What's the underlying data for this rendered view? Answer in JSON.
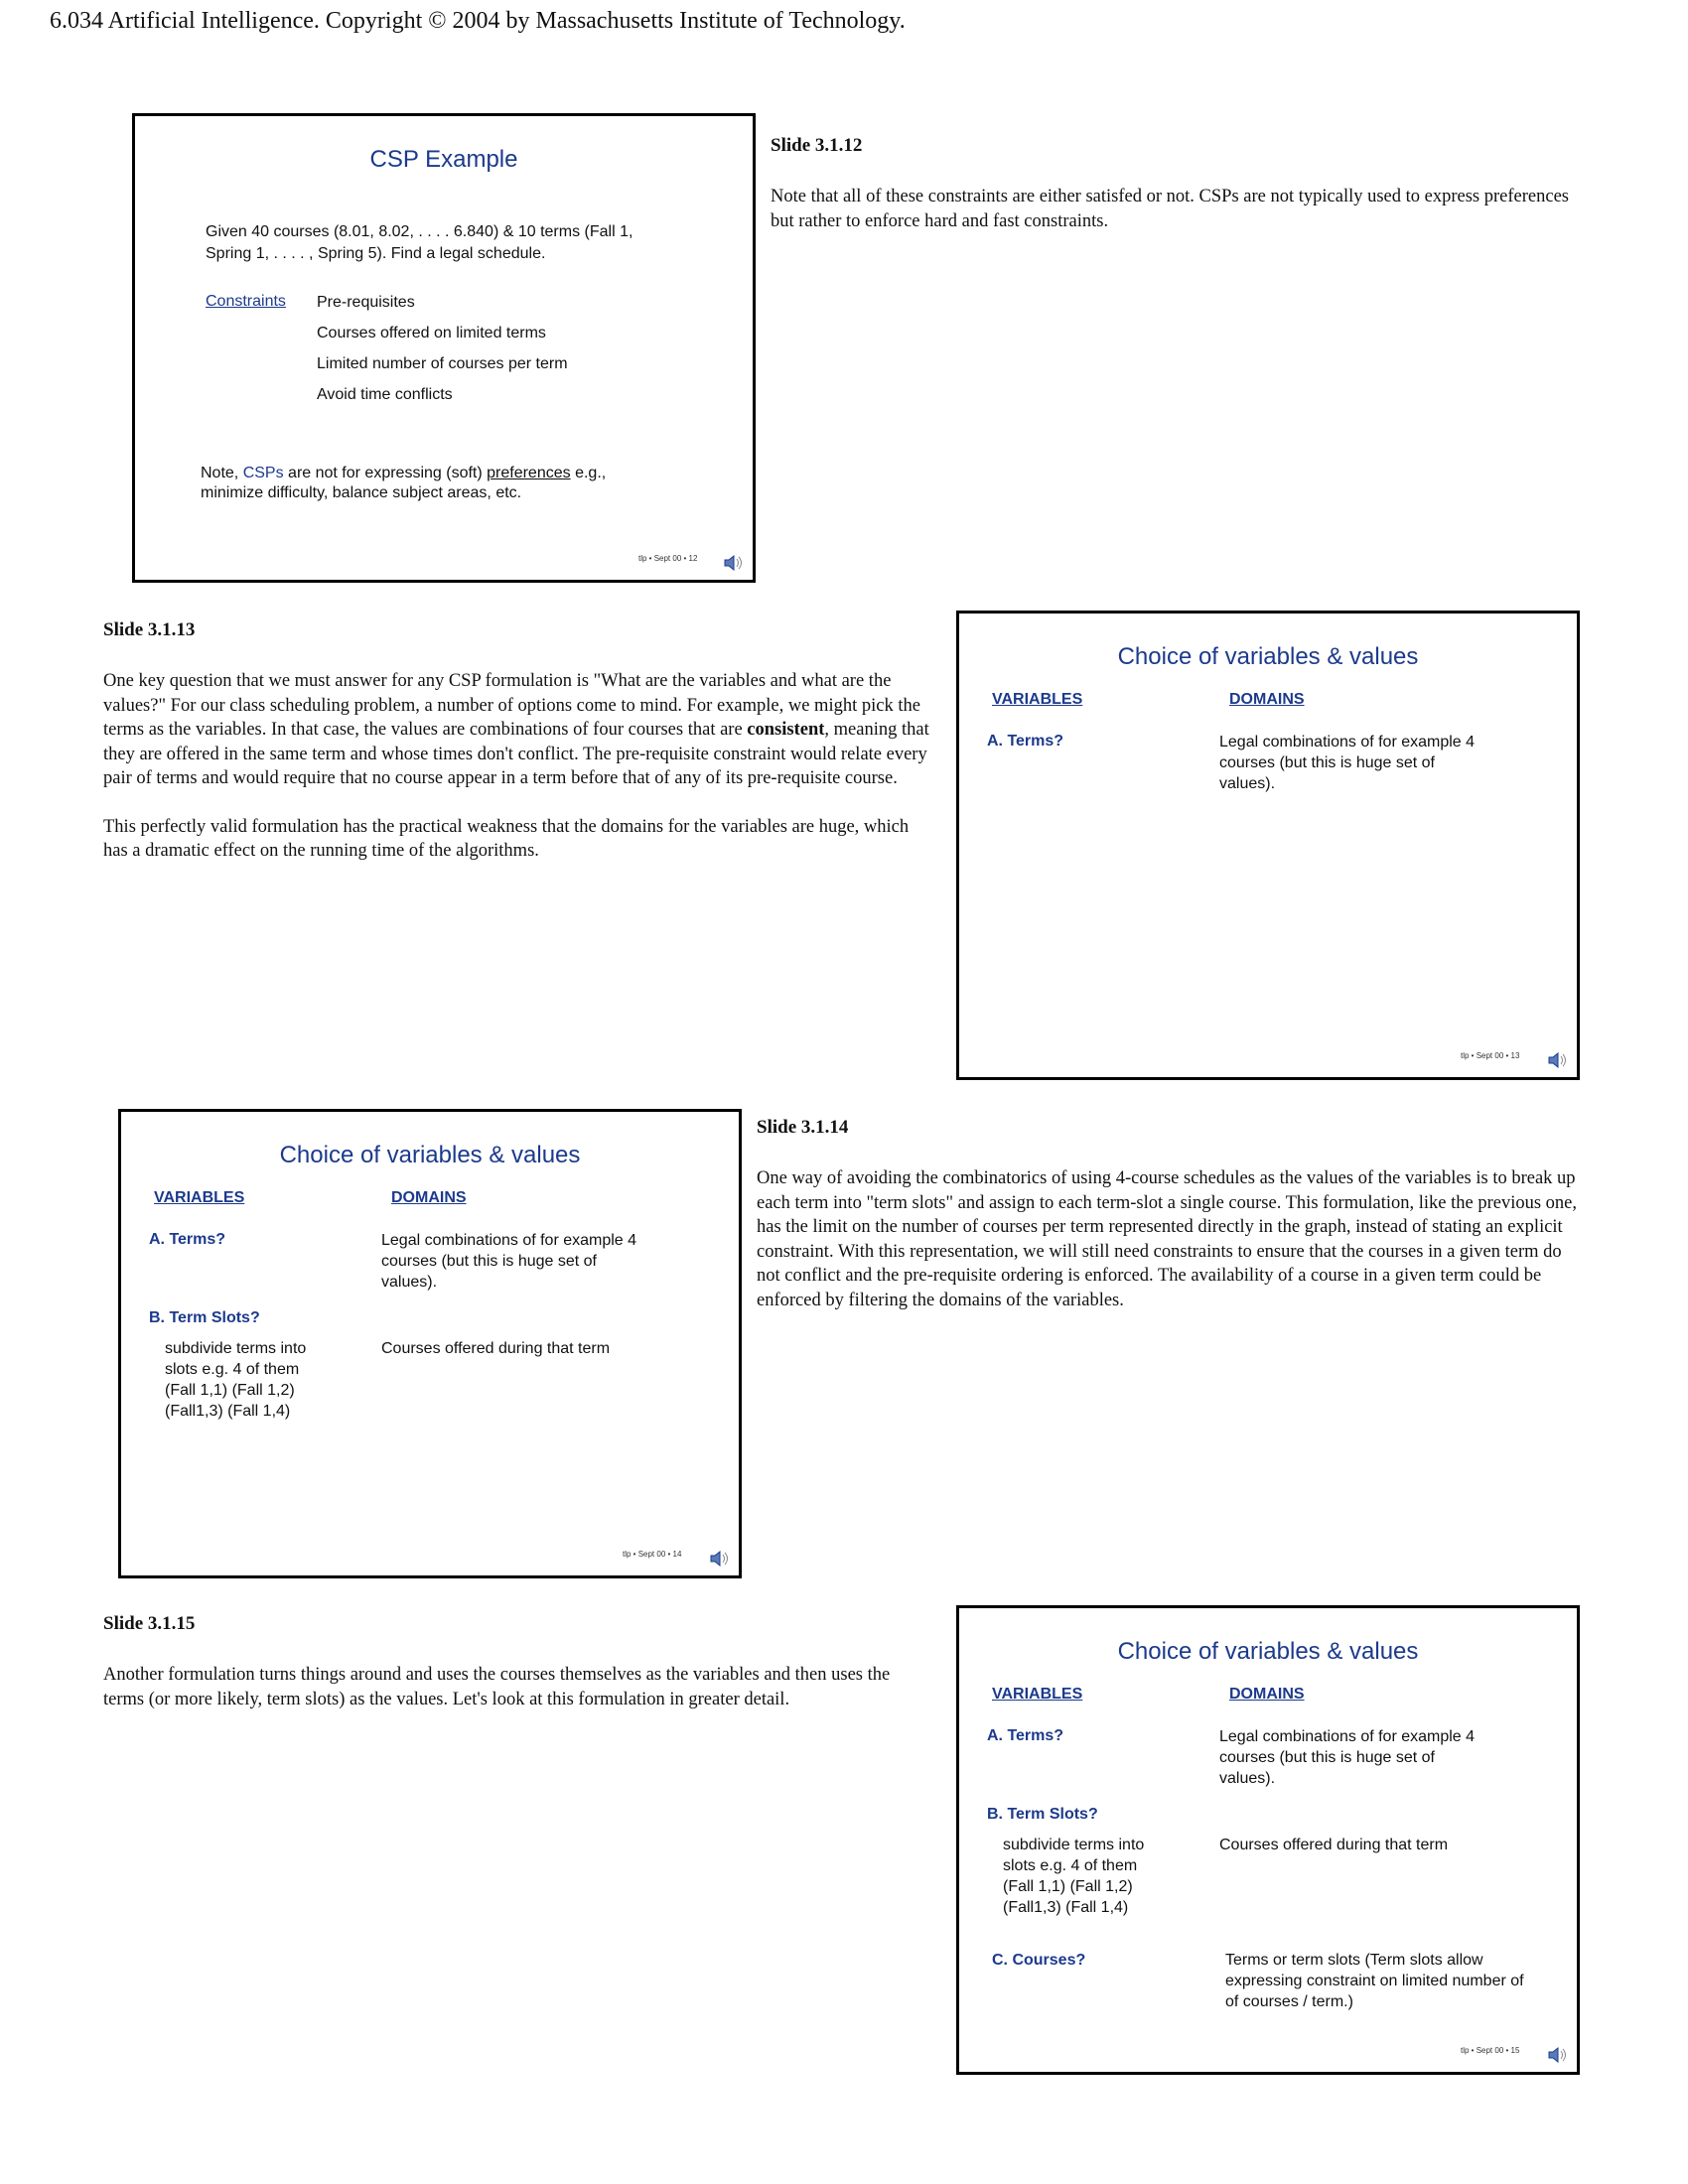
{
  "header": "6.034 Artificial Intelligence. Copyright © 2004 by Massachusetts Institute of Technology.",
  "slide12": {
    "title": "CSP Example",
    "given_line1": "Given 40 courses (8.01, 8.02, . . . . 6.840) & 10 terms (Fall 1,",
    "given_line2": "Spring 1, . . . . , Spring 5).  Find a legal schedule.",
    "constraints_label": "Constraints",
    "constraints": [
      "Pre-requisites",
      "Courses offered on limited terms",
      "Limited number of courses per term",
      "Avoid time conflicts"
    ],
    "note_prefix": "Note, ",
    "note_csps": "CSPs",
    "note_mid": " are not for expressing (soft) ",
    "note_pref": "preferences",
    "note_end": " e.g.,",
    "note_line2": "minimize difficulty, balance subject areas, etc.",
    "footer": "tlp • Sept 00 • 12",
    "heading": "Slide 3.1.12",
    "text": "Note that all of these constraints are either satisfed or not. CSPs are not typically used to express preferences but rather to enforce hard and fast constraints."
  },
  "slide13": {
    "title": "Choice of variables & values",
    "col_variables": "VARIABLES",
    "col_domains": "DOMAINS",
    "a_label": "A. Terms?",
    "a_domain": [
      "Legal combinations of for example 4",
      "courses (but this is huge set of",
      "values)."
    ],
    "footer": "tlp • Sept 00 • 13",
    "heading": "Slide 3.1.13",
    "p1_before": "One key question that we must answer for any CSP formulation is \"What are the variables and what are the values?\" For our class scheduling problem, a number of options come to mind. For example, we might pick the terms as the variables. In that case, the values are combinations of four courses that are ",
    "p1_bold": "consistent",
    "p1_after": ", meaning that they are offered in the same term and whose times don't conflict. The pre-requisite constraint would relate every pair of terms and would require that no course appear in a term before that of any of its pre-requisite course.",
    "p2": "This perfectly valid formulation has the practical weakness that the domains for the variables are huge, which has a dramatic effect on the running time of the algorithms."
  },
  "slide14": {
    "title": "Choice of variables & values",
    "col_variables": "VARIABLES",
    "col_domains": "DOMAINS",
    "a_label": "A. Terms?",
    "a_domain": [
      "Legal combinations of for example 4",
      "courses (but this is huge set of",
      "values)."
    ],
    "b_label_letter": "B. ",
    "b_label_text": "Term Slots?",
    "b_desc": [
      "subdivide terms into",
      "slots e.g. 4 of them",
      "(Fall 1,1) (Fall 1,2)",
      "(Fall1,3) (Fall 1,4)"
    ],
    "b_domain": "Courses offered during that term",
    "footer": "tlp • Sept 00 • 14",
    "heading": "Slide 3.1.14",
    "text": "One way of avoiding the combinatorics of using 4-course schedules as the values of the variables is to break up each term into \"term slots\" and assign to each term-slot a single course. This formulation, like the previous one, has the limit on the number of courses per term represented directly in the graph, instead of stating an explicit constraint. With this representation, we will still need constraints to ensure that the courses in a given term do not conflict and the pre-requisite ordering is enforced. The availability of a course in a given term could be enforced by filtering the domains of the variables."
  },
  "slide15": {
    "title": "Choice of variables & values",
    "col_variables": "VARIABLES",
    "col_domains": "DOMAINS",
    "a_label": "A. Terms?",
    "a_domain": [
      "Legal combinations of for example 4",
      "courses (but this is huge set of",
      "values)."
    ],
    "b_label": "B. Term Slots?",
    "b_desc": [
      "subdivide terms into",
      "slots e.g. 4 of them",
      "(Fall 1,1) (Fall 1,2)",
      "(Fall1,3) (Fall 1,4)"
    ],
    "b_domain": "Courses offered during that term",
    "c_label": "C. Courses?",
    "c_domain": [
      "Terms or term slots (Term slots allow",
      "expressing constraint on limited number of",
      "of courses / term.)"
    ],
    "footer": "tlp • Sept 00 • 15",
    "heading": "Slide 3.1.15",
    "text": "Another formulation turns things around and uses the courses themselves as the variables and then uses the terms (or more likely, term slots) as the values. Let's look at this formulation in greater detail."
  },
  "icons": {
    "speaker": "speaker-icon"
  }
}
